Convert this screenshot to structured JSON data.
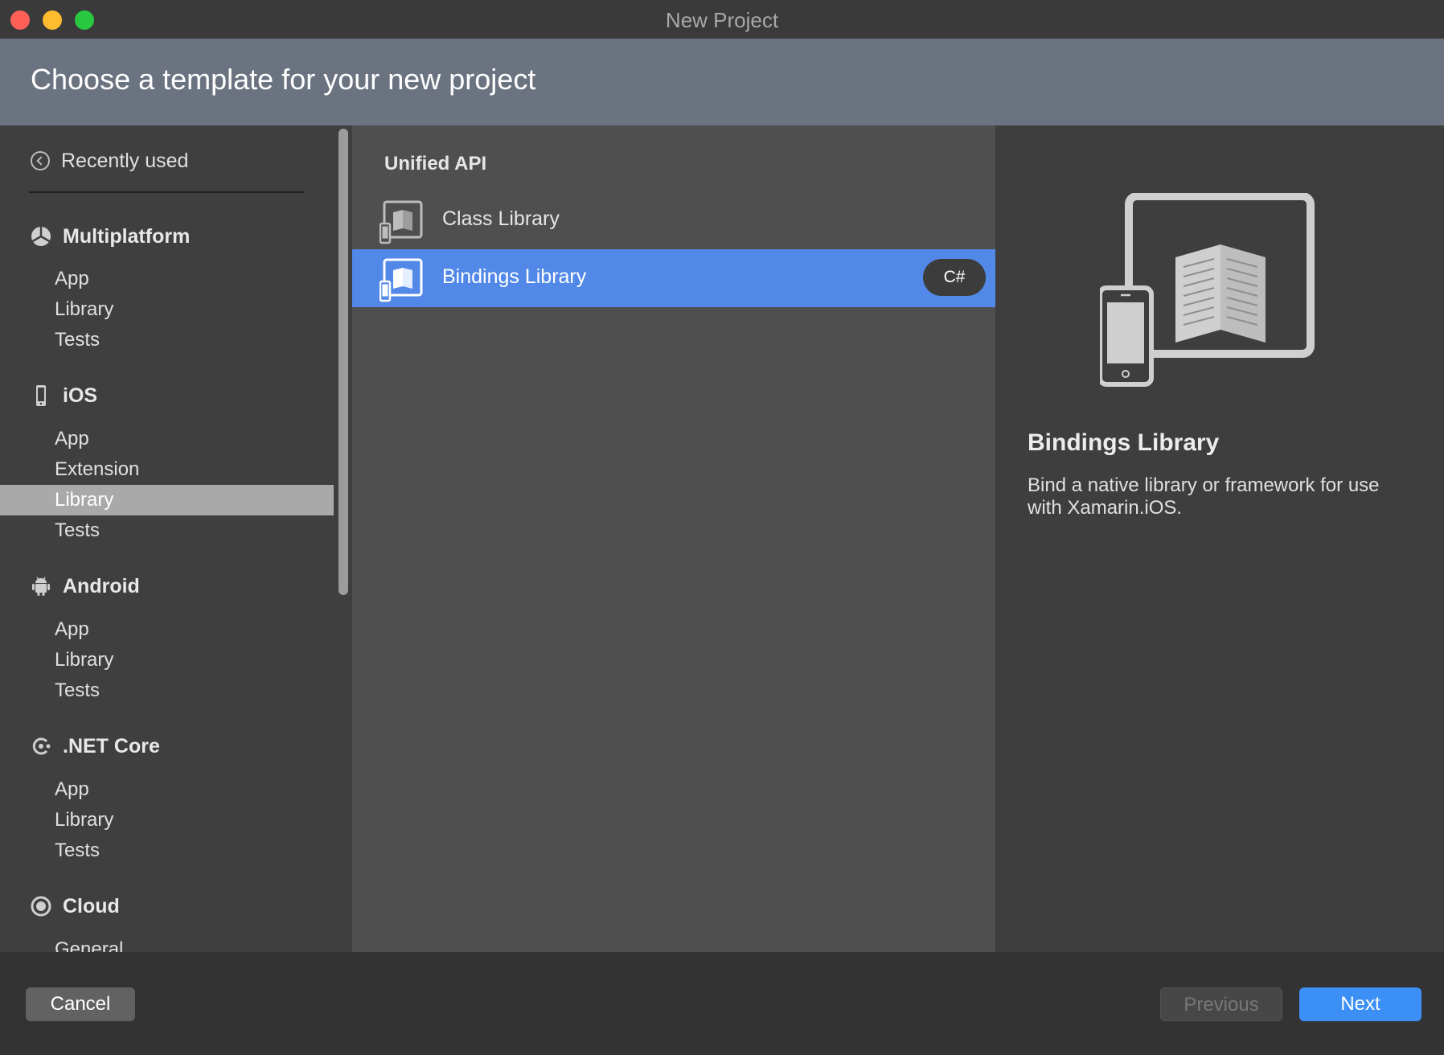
{
  "window": {
    "title": "New Project"
  },
  "header": {
    "title": "Choose a template for your new project"
  },
  "sidebar": {
    "recently_used": "Recently used",
    "categories": [
      {
        "name": "Multiplatform",
        "icon": "multiplatform-icon",
        "items": [
          "App",
          "Library",
          "Tests"
        ]
      },
      {
        "name": "iOS",
        "icon": "phone-icon",
        "items": [
          "App",
          "Extension",
          "Library",
          "Tests"
        ]
      },
      {
        "name": "Android",
        "icon": "android-icon",
        "items": [
          "App",
          "Library",
          "Tests"
        ]
      },
      {
        "name": ".NET Core",
        "icon": "dotnet-icon",
        "items": [
          "App",
          "Library",
          "Tests"
        ]
      },
      {
        "name": "Cloud",
        "icon": "cloud-icon",
        "items": [
          "General"
        ]
      }
    ],
    "selected": "iOS > Library"
  },
  "templates": {
    "section": "Unified API",
    "items": [
      {
        "label": "Class Library",
        "icon": "class-library-icon",
        "selected": false
      },
      {
        "label": "Bindings Library",
        "icon": "bindings-library-icon",
        "selected": true,
        "language": "C#"
      }
    ]
  },
  "detail": {
    "title": "Bindings Library",
    "description": "Bind a native library or framework for use with Xamarin.iOS.",
    "illustration": "device-book-icon"
  },
  "footer": {
    "cancel": "Cancel",
    "previous": "Previous",
    "next": "Next"
  },
  "colors": {
    "header_bg": "#6c7380",
    "selection": "#5288e8",
    "primary_button": "#3b8ff5"
  }
}
